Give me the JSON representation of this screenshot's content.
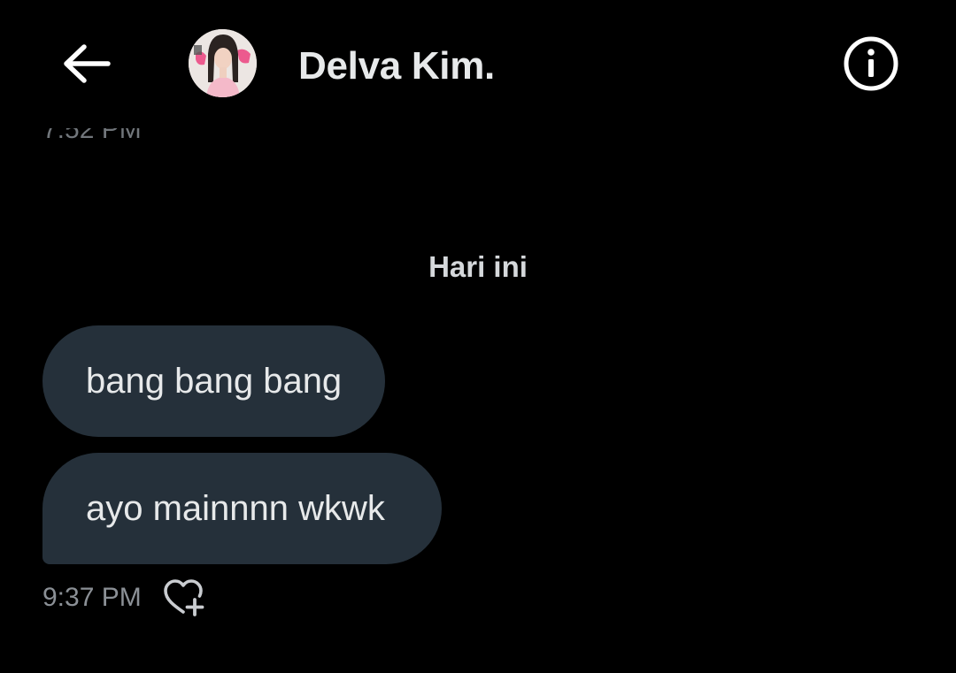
{
  "header": {
    "back_icon": "arrow-left-icon",
    "contact_name": "Delva Kim.",
    "info_icon": "info-circle-icon"
  },
  "conversation": {
    "previous_timestamp": "7:52 PM",
    "day_separator": "Hari ini",
    "messages": [
      {
        "text": "bang bang bang"
      },
      {
        "text": "ayo mainnnn wkwk"
      }
    ],
    "last_timestamp": "9:37 PM",
    "reaction_icon": "heart-plus-icon"
  },
  "colors": {
    "background": "#000000",
    "bubble": "#25303a",
    "text": "#e7e9ea",
    "muted": "#71767b"
  }
}
